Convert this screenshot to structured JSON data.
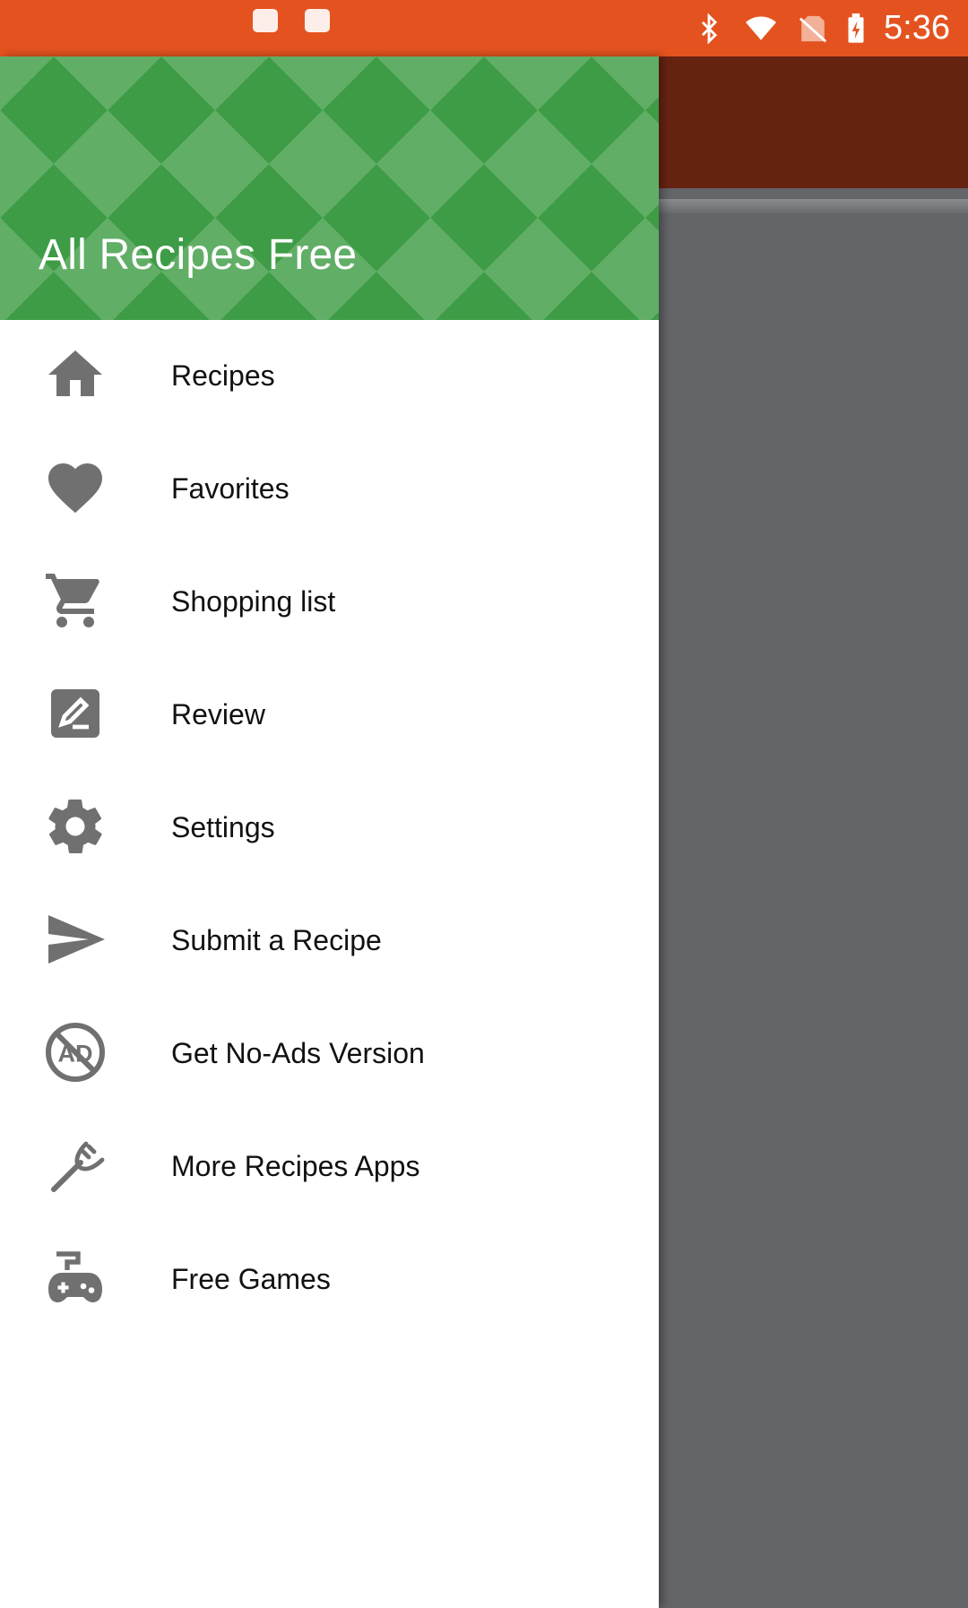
{
  "status_bar": {
    "time": "5:36",
    "icons": [
      "bluetooth-icon",
      "wifi-icon",
      "no-sim-icon",
      "battery-charging-icon"
    ],
    "notifications": [
      "notification-icon-1",
      "notification-icon-2"
    ],
    "color": "#e4531f"
  },
  "drawer": {
    "title": "All Recipes Free",
    "header_color": "#3e9c46",
    "items": [
      {
        "label": "Recipes",
        "icon": "home-icon"
      },
      {
        "label": "Favorites",
        "icon": "heart-icon"
      },
      {
        "label": "Shopping list",
        "icon": "cart-icon"
      },
      {
        "label": "Review",
        "icon": "edit-icon"
      },
      {
        "label": "Settings",
        "icon": "gear-icon"
      },
      {
        "label": "Submit a Recipe",
        "icon": "send-icon"
      },
      {
        "label": "Get No-Ads Version",
        "icon": "no-ads-icon"
      },
      {
        "label": "More Recipes Apps",
        "icon": "fork-icon"
      },
      {
        "label": "Free Games",
        "icon": "gamepad-icon"
      }
    ]
  },
  "background": {
    "appbar_color": "#672312",
    "scrim_color": "#646568"
  }
}
